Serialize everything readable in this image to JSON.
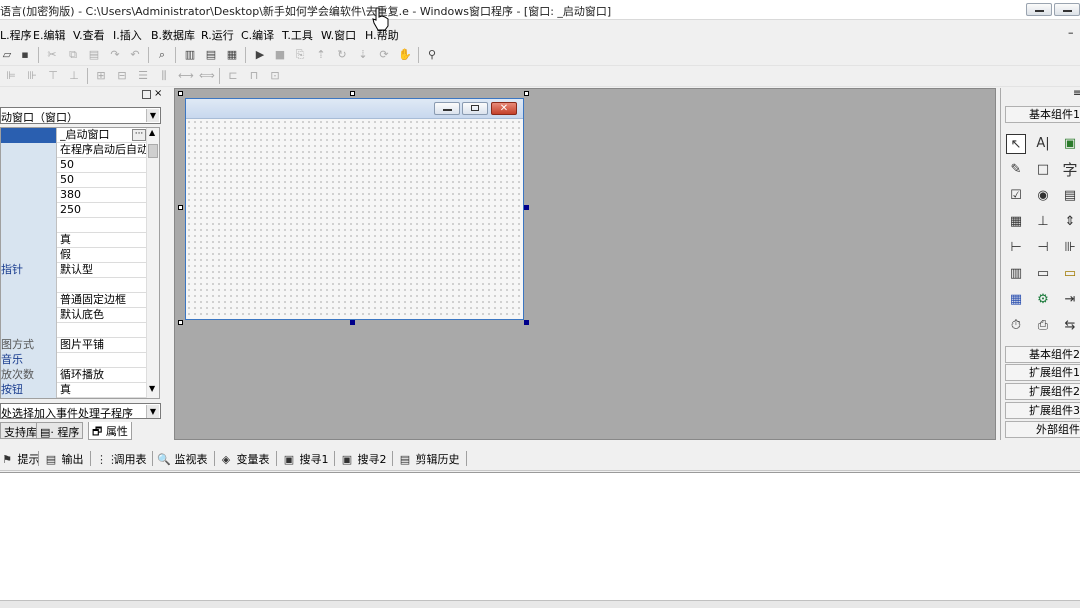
{
  "title": "语言(加密狗版) - C:\\Users\\Administrator\\Desktop\\新手如何学会编软件\\去重复.e - Windows窗口程序 - [窗口: _启动窗口]",
  "menu": [
    "L.程序",
    "E.编辑",
    "V.查看",
    "I.插入",
    "B.数据库",
    "R.运行",
    "C.编译",
    "T.工具",
    "W.窗口",
    "H.帮助"
  ],
  "object_selector": "动窗口（窗口）",
  "properties": [
    {
      "name": "",
      "value": "_启动窗口"
    },
    {
      "name": "",
      "value": "在程序启动后自动"
    },
    {
      "name": "",
      "value": "50"
    },
    {
      "name": "",
      "value": "50"
    },
    {
      "name": "",
      "value": "380"
    },
    {
      "name": "",
      "value": "250"
    },
    {
      "name": "",
      "value": ""
    },
    {
      "name": "",
      "value": "真"
    },
    {
      "name": "",
      "value": "假"
    },
    {
      "name": "指针",
      "value": "默认型"
    },
    {
      "name": "",
      "value": ""
    },
    {
      "name": "",
      "value": "普通固定边框"
    },
    {
      "name": "",
      "value": "默认底色"
    },
    {
      "name": "",
      "value": ""
    },
    {
      "name": "图方式",
      "value": "图片平铺"
    },
    {
      "name": "音乐",
      "value": ""
    },
    {
      "name": "放次数",
      "value": "循环播放"
    },
    {
      "name": "按钮",
      "value": "真"
    }
  ],
  "event_selector": "处选择加入事件处理子程序",
  "left_tabs": [
    "支持库",
    "程序",
    "属性"
  ],
  "component_categories_top": "基本组件1",
  "component_categories_bottom": [
    "基本组件2",
    "扩展组件1",
    "扩展组件2",
    "扩展组件3",
    "外部组件"
  ],
  "component_icons": [
    "↖",
    "A|",
    "▣",
    "✎",
    "□",
    "字",
    "☑",
    "◉",
    "▤",
    "▦",
    "⊥",
    "⇕",
    "⊢",
    "⊣",
    "⊪",
    "▥",
    "▭",
    "▭",
    "▦",
    "⚙",
    "⇥",
    "⏱",
    "⎙",
    "⇆"
  ],
  "bottom_tabs": [
    {
      "icon": "⚑",
      "label": "提示"
    },
    {
      "icon": "▤",
      "label": "输出"
    },
    {
      "icon": "⋮⋮",
      "label": "调用表"
    },
    {
      "icon": "🔍",
      "label": "监视表"
    },
    {
      "icon": "◈",
      "label": "变量表"
    },
    {
      "icon": "▣",
      "label": "搜寻1"
    },
    {
      "icon": "▣",
      "label": "搜寻2"
    },
    {
      "icon": "▤",
      "label": "剪辑历史"
    }
  ],
  "colors": {
    "design_bg": "#a9a9a9",
    "form_border": "#3b76c2",
    "property_name": "#1a3d8f",
    "close_button": "#c4402a"
  }
}
